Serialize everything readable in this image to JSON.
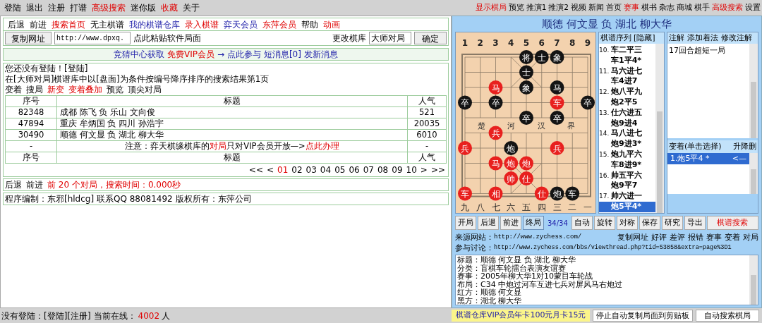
{
  "menu": {
    "left": [
      {
        "label": "登陆",
        "kind": "plain"
      },
      {
        "label": "退出",
        "kind": "plain"
      },
      {
        "label": "注册",
        "kind": "plain"
      },
      {
        "label": "打谱",
        "kind": "plain"
      },
      {
        "label": "高级搜索",
        "kind": "highlight"
      },
      {
        "label": "迷你版",
        "kind": "plain"
      },
      {
        "label": "收藏",
        "kind": "highlight"
      },
      {
        "label": "关于",
        "kind": "plain"
      }
    ],
    "right": [
      {
        "label": "显示棋局",
        "kind": "highlight"
      },
      {
        "label": "预览",
        "kind": "plain"
      },
      {
        "label": "推演1",
        "kind": "plain"
      },
      {
        "label": "推演2",
        "kind": "plain"
      },
      {
        "label": "视频",
        "kind": "plain"
      },
      {
        "label": "新闻",
        "kind": "plain"
      },
      {
        "label": "首页",
        "kind": "plain"
      },
      {
        "label": "赛事",
        "kind": "highlight"
      },
      {
        "label": "棋书",
        "kind": "plain"
      },
      {
        "label": "杂志",
        "kind": "plain"
      },
      {
        "label": "商城",
        "kind": "plain"
      },
      {
        "label": "棋手",
        "kind": "plain"
      },
      {
        "label": "高级搜索",
        "kind": "highlight"
      },
      {
        "label": "设置",
        "kind": "plain"
      }
    ]
  },
  "nav": [
    {
      "label": "后退",
      "kind": "plain"
    },
    {
      "label": "前进",
      "kind": "plain"
    },
    {
      "label": "搜索首页",
      "kind": "highlight"
    },
    {
      "label": "无主棋谱",
      "kind": "plain"
    },
    {
      "label": "我的棋谱仓库",
      "kind": "link"
    },
    {
      "label": "录入棋谱",
      "kind": "highlight"
    },
    {
      "label": "弈天会员",
      "kind": "link"
    },
    {
      "label": "东萍会员",
      "kind": "highlight"
    },
    {
      "label": "帮助",
      "kind": "plain"
    },
    {
      "label": "动画",
      "kind": "highlight"
    }
  ],
  "url_bar": {
    "copy_button": "复制网址",
    "url": "http://www.dpxq.",
    "paste_hint": "点此粘贴软件局面",
    "db_label": "更改棋库",
    "db_value": "大师对局",
    "ok_button": "确定"
  },
  "banner": [
    {
      "text": "竞猜中心获取",
      "kind": "link"
    },
    {
      "text": "免费VIP会员",
      "kind": "highlight"
    },
    {
      "text": "→ 点此参与",
      "kind": "link"
    },
    {
      "text": "短消息[0]",
      "kind": "link"
    },
    {
      "text": "发新消息",
      "kind": "link"
    }
  ],
  "login_notice": "您还没有登陆！[登陆]",
  "search_summary": "在[大师对局]棋谱库中以[盘面]为条件按编号降序排序的搜索结果第1页",
  "view_links": [
    {
      "label": "变着",
      "kind": "plain"
    },
    {
      "label": "搜局",
      "kind": "plain"
    },
    {
      "label": "新变",
      "kind": "highlight"
    },
    {
      "label": "变着叠加",
      "kind": "highlight"
    },
    {
      "label": "预览",
      "kind": "plain"
    },
    {
      "label": "顶尖对局",
      "kind": "plain"
    }
  ],
  "table": {
    "columns": [
      "序号",
      "标题",
      "人气"
    ],
    "rows": [
      {
        "id": "82348",
        "title": "成都 陈飞 负 乐山 文向俊",
        "popularity": "521"
      },
      {
        "id": "47894",
        "title": "重庆 牟炳国 负 四川 孙浩宇",
        "popularity": "20035"
      },
      {
        "id": "30490",
        "title": "顺德 何文显 负 湖北 柳大华",
        "popularity": "6010"
      }
    ],
    "notice": {
      "column_1": "-",
      "parts": [
        {
          "text": "注意：弈天棋缘棋库的",
          "kind": "plain"
        },
        {
          "text": "对局",
          "kind": "highlight"
        },
        {
          "text": "只对VIP会员开放—>",
          "kind": "plain"
        },
        {
          "text": "点此办理",
          "kind": "highlight"
        }
      ],
      "column_3": "-"
    },
    "footer_columns": [
      "序号",
      "标题",
      "人气"
    ]
  },
  "pagination": [
    {
      "label": "<<",
      "selected": false
    },
    {
      "label": "<",
      "selected": false
    },
    {
      "label": "01",
      "selected": true
    },
    {
      "label": "02",
      "selected": false
    },
    {
      "label": "03",
      "selected": false
    },
    {
      "label": "04",
      "selected": false
    },
    {
      "label": "05",
      "selected": false
    },
    {
      "label": "06",
      "selected": false
    },
    {
      "label": "07",
      "selected": false
    },
    {
      "label": "08",
      "selected": false
    },
    {
      "label": "09",
      "selected": false
    },
    {
      "label": "10",
      "selected": false
    },
    {
      "label": ">",
      "selected": false
    },
    {
      "label": ">>",
      "selected": false
    }
  ],
  "result_nav": {
    "back": "后退",
    "forward": "前进",
    "summary": "前 20 个对局，搜索时间：0.000秒"
  },
  "credits": "程序编制：东邪[hldcg] 联系QQ 88081492 版权所有：东萍公司",
  "game_title": "顺德 何文显 负 湖北 柳大华",
  "board": {
    "top_files": [
      "1",
      "2",
      "3",
      "4",
      "5",
      "6",
      "7",
      "8",
      "9"
    ],
    "bottom_files": [
      "九",
      "八",
      "七",
      "六",
      "五",
      "四",
      "三",
      "二",
      "一"
    ],
    "river": [
      "楚",
      "河",
      "汉",
      "界"
    ],
    "ranks": [
      [
        {
          "kind": "empty"
        },
        {
          "kind": "empty"
        },
        {
          "kind": "empty"
        },
        {
          "kind": "empty"
        },
        {
          "kind": "piece",
          "char": "将",
          "color": "#141414"
        },
        {
          "kind": "piece",
          "char": "士",
          "color": "#141414"
        },
        {
          "kind": "piece",
          "char": "象",
          "color": "#141414"
        },
        {
          "kind": "empty"
        },
        {
          "kind": "empty"
        }
      ],
      [
        {
          "kind": "empty"
        },
        {
          "kind": "empty"
        },
        {
          "kind": "empty"
        },
        {
          "kind": "empty"
        },
        {
          "kind": "piece",
          "char": "士",
          "color": "#141414"
        },
        {
          "kind": "empty"
        },
        {
          "kind": "empty"
        },
        {
          "kind": "empty"
        },
        {
          "kind": "empty"
        }
      ],
      [
        {
          "kind": "empty"
        },
        {
          "kind": "empty"
        },
        {
          "kind": "piece",
          "char": "马",
          "color": "#e8201e"
        },
        {
          "kind": "empty"
        },
        {
          "kind": "piece",
          "char": "象",
          "color": "#141414"
        },
        {
          "kind": "empty"
        },
        {
          "kind": "piece",
          "char": "马",
          "color": "#141414"
        },
        {
          "kind": "empty"
        },
        {
          "kind": "empty"
        }
      ],
      [
        {
          "kind": "piece",
          "char": "卒",
          "color": "#141414"
        },
        {
          "kind": "empty"
        },
        {
          "kind": "piece",
          "char": "卒",
          "color": "#141414"
        },
        {
          "kind": "empty"
        },
        {
          "kind": "empty"
        },
        {
          "kind": "empty"
        },
        {
          "kind": "piece",
          "char": "车",
          "color": "#e8201e"
        },
        {
          "kind": "empty"
        },
        {
          "kind": "piece",
          "char": "卒",
          "color": "#141414"
        }
      ],
      [
        {
          "kind": "empty"
        },
        {
          "kind": "empty"
        },
        {
          "kind": "empty"
        },
        {
          "kind": "empty"
        },
        {
          "kind": "piece",
          "char": "卒",
          "color": "#141414"
        },
        {
          "kind": "empty"
        },
        {
          "kind": "piece",
          "char": "卒",
          "color": "#141414"
        },
        {
          "kind": "empty"
        },
        {
          "kind": "empty"
        }
      ],
      [
        {
          "kind": "empty"
        },
        {
          "kind": "empty"
        },
        {
          "kind": "piece",
          "char": "兵",
          "color": "#e8201e"
        },
        {
          "kind": "empty"
        },
        {
          "kind": "empty"
        },
        {
          "kind": "empty"
        },
        {
          "kind": "empty"
        },
        {
          "kind": "empty"
        },
        {
          "kind": "empty"
        }
      ],
      [
        {
          "kind": "piece",
          "char": "兵",
          "color": "#e8201e"
        },
        {
          "kind": "empty"
        },
        {
          "kind": "empty"
        },
        {
          "kind": "piece",
          "char": "炮",
          "color": "#141414"
        },
        {
          "kind": "empty"
        },
        {
          "kind": "empty"
        },
        {
          "kind": "piece",
          "char": "兵",
          "color": "#e8201e"
        },
        {
          "kind": "empty"
        },
        {
          "kind": "empty"
        }
      ],
      [
        {
          "kind": "empty"
        },
        {
          "kind": "empty"
        },
        {
          "kind": "piece",
          "char": "马",
          "color": "#e8201e"
        },
        {
          "kind": "piece",
          "char": "炮",
          "color": "#e8201e"
        },
        {
          "kind": "piece",
          "char": "炮",
          "color": "#e8201e"
        },
        {
          "kind": "empty"
        },
        {
          "kind": "empty"
        },
        {
          "kind": "empty"
        },
        {
          "kind": "empty"
        }
      ],
      [
        {
          "kind": "empty"
        },
        {
          "kind": "empty"
        },
        {
          "kind": "empty"
        },
        {
          "kind": "piece",
          "char": "帅",
          "color": "#e8201e"
        },
        {
          "kind": "piece",
          "char": "仕",
          "color": "#e8201e"
        },
        {
          "kind": "empty"
        },
        {
          "kind": "empty"
        },
        {
          "kind": "empty"
        },
        {
          "kind": "empty"
        }
      ],
      [
        {
          "kind": "piece",
          "char": "车",
          "color": "#e8201e"
        },
        {
          "kind": "empty"
        },
        {
          "kind": "piece",
          "char": "相",
          "color": "#e8201e"
        },
        {
          "kind": "empty"
        },
        {
          "kind": "empty"
        },
        {
          "kind": "piece",
          "char": "仕",
          "color": "#e8201e"
        },
        {
          "kind": "piece",
          "char": "炮",
          "color": "#141414"
        },
        {
          "kind": "piece",
          "char": "车",
          "color": "#141414"
        },
        {
          "kind": "empty"
        }
      ]
    ]
  },
  "moves": {
    "header": "棋谱序列",
    "hide": "[隐藏]",
    "lines": [
      {
        "number": "10.",
        "move": "车二平三",
        "selected": false
      },
      {
        "move": "车1平4*",
        "selected": false
      },
      {
        "number": "11.",
        "move": "马六进七",
        "selected": false
      },
      {
        "move": "车4进7",
        "selected": false
      },
      {
        "number": "12.",
        "move": "炮八平九",
        "selected": false
      },
      {
        "move": "炮2平5",
        "selected": false
      },
      {
        "number": "13.",
        "move": "仕六进五",
        "selected": false
      },
      {
        "move": "炮9进4",
        "selected": false
      },
      {
        "number": "14.",
        "move": "马八进七",
        "selected": false
      },
      {
        "move": "炮9进3*",
        "selected": false
      },
      {
        "number": "15.",
        "move": "炮九平六",
        "selected": false
      },
      {
        "move": "车8进9*",
        "selected": false
      },
      {
        "number": "16.",
        "move": "帅五平六",
        "selected": false
      },
      {
        "move": "炮9平7",
        "selected": false
      },
      {
        "number": "17.",
        "move": "帅六进一",
        "selected": false
      },
      {
        "move": "炮5平4*",
        "selected": true
      }
    ]
  },
  "notes": {
    "tabs": [
      "注解",
      "添加着法",
      "修改注解"
    ],
    "text": "17回合超短一局",
    "variations_header": "变着(单击选择)",
    "variations_actions": "升降删",
    "variations": [
      {
        "label": "1.炮5平4 *",
        "arrow": "<—",
        "selected": true
      }
    ]
  },
  "controls": [
    {
      "label": "开局",
      "kind": "button",
      "selected": false
    },
    {
      "label": "后退",
      "kind": "button",
      "selected": false
    },
    {
      "label": "前进",
      "kind": "button",
      "selected": false
    },
    {
      "label": "终局",
      "kind": "button",
      "selected": true
    },
    {
      "label": "34/34",
      "kind": "counter"
    },
    {
      "label": "自动",
      "kind": "button",
      "selected": false
    },
    {
      "label": "旋转",
      "kind": "button",
      "selected": false
    },
    {
      "label": "对称",
      "kind": "button",
      "selected": false
    },
    {
      "label": "保存",
      "kind": "button",
      "selected": false
    },
    {
      "label": "研究",
      "kind": "button",
      "selected": false
    },
    {
      "label": "导出",
      "kind": "button",
      "selected": false
    },
    {
      "label": "棋谱搜索",
      "kind": "search",
      "selected": false
    }
  ],
  "source": {
    "site_label": "来源网站：",
    "site_url": "http://www.zychess.com/",
    "actions": [
      "复制网址",
      "好评",
      "差评",
      "报错",
      "赛事",
      "变着",
      "对局"
    ],
    "discuss_label": "参与讨论：",
    "discuss_url": "http://www.zychess.com/bbs/viewthread.php?tid=53858&extra=page%3D1"
  },
  "info": [
    {
      "label": "标题：",
      "value": "顺德 何文显 负 湖北 柳大华"
    },
    {
      "label": "分类：",
      "value": "盲棋车轮擂台表演友谊赛"
    },
    {
      "label": "赛事：",
      "value": "2005年柳大华1对10蒙目车轮战"
    },
    {
      "label": "布局：",
      "value": "C34 中炮过河车互进七兵对屏风马右炮过"
    },
    {
      "label": "红方：",
      "value": "顺德 何文显"
    },
    {
      "label": "黑方：",
      "value": "湖北 柳大华"
    }
  ],
  "status_bar": {
    "prefix": "没有登陆：[登陆][注册] 当前在线：",
    "online": "4002",
    "suffix": "人",
    "vip": "棋谱仓库VIP会员年卡100元月卡15元",
    "clip_button": "停止自动复制局面到剪贴板",
    "search_button": "自动搜索棋局"
  }
}
